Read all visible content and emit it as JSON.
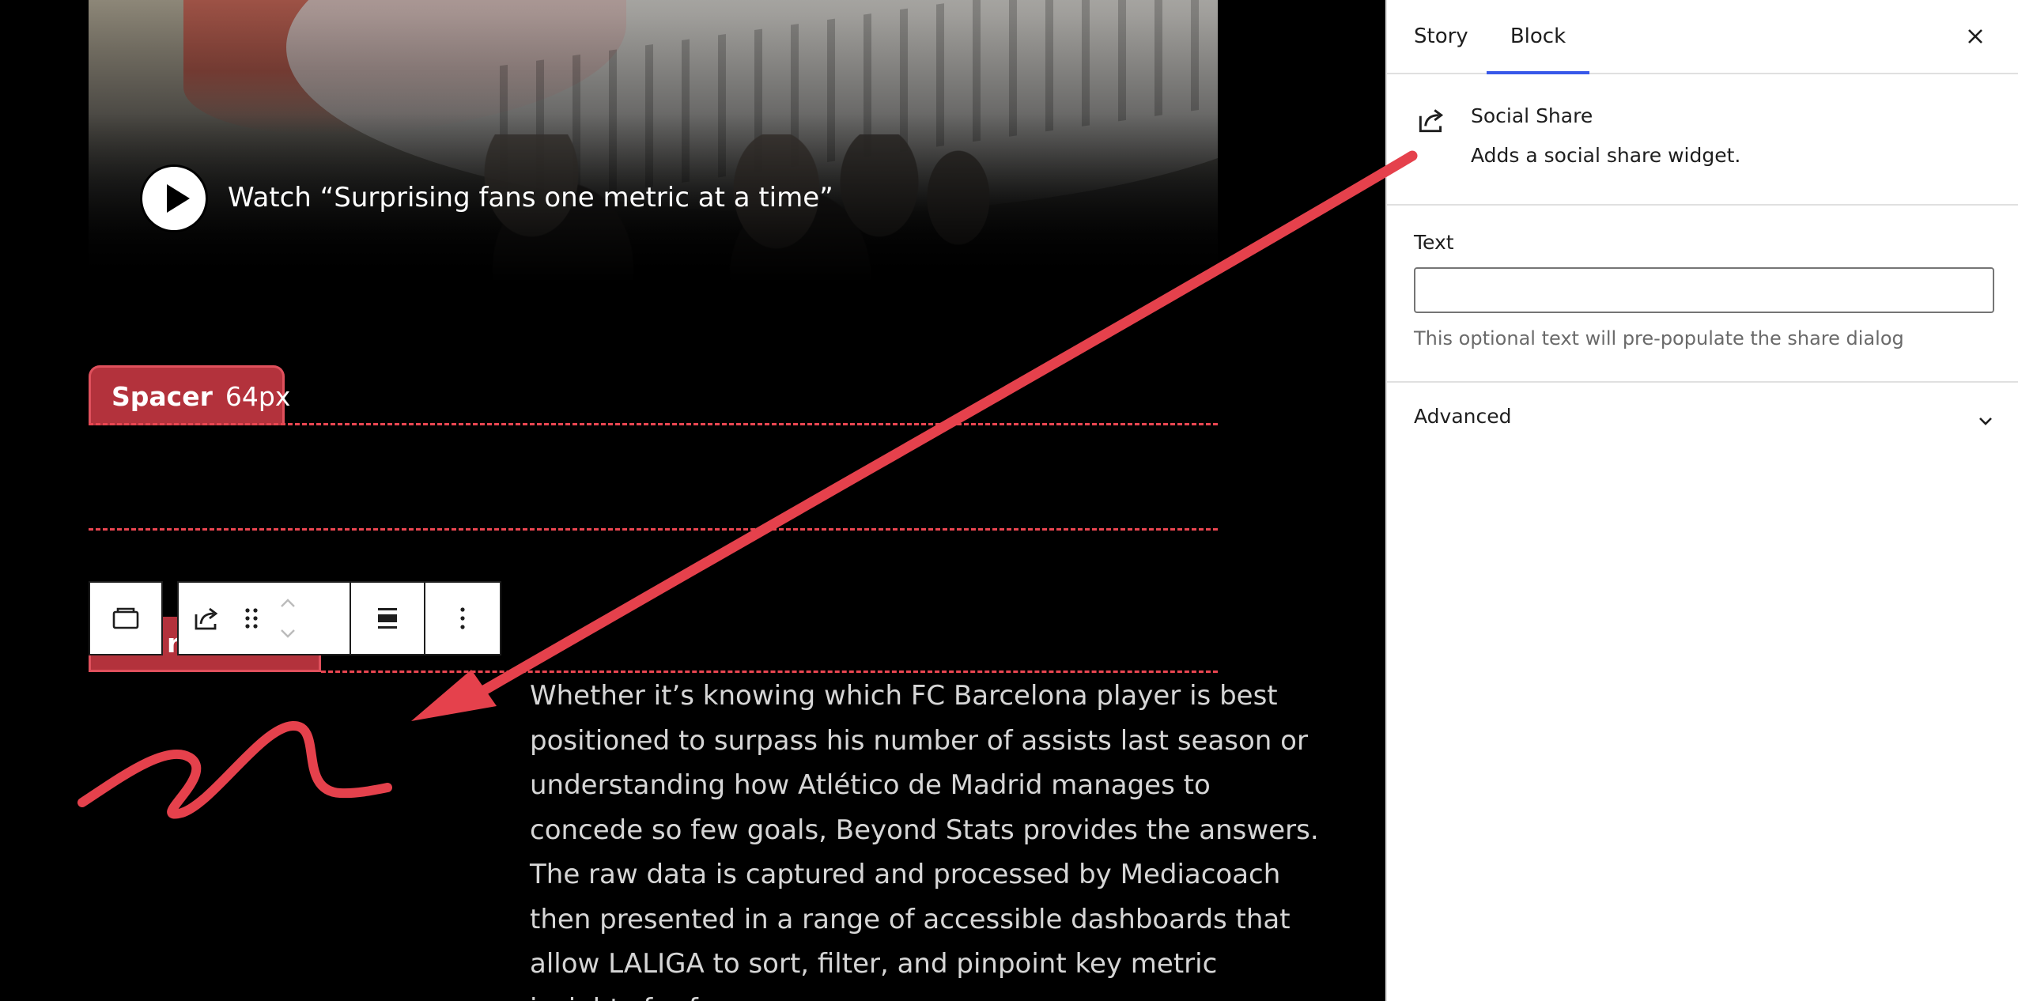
{
  "video": {
    "title": "Watch “Surprising fans one metric at a time”"
  },
  "spacer": {
    "name": "Spacer",
    "size": "64px"
  },
  "share_block_partial": "r",
  "toolbar": {
    "icons": [
      "parent-block-icon",
      "social-share-icon",
      "drag-handle-icon",
      "move-up-icon",
      "move-down-icon",
      "align-icon",
      "more-options-icon"
    ]
  },
  "body_text": {
    "lines": [
      "Whether it’s knowing which FC Barcelona player is best",
      "positioned to surpass his number of assists last season or",
      "understanding how Atlético de Madrid manages to",
      "concede so few goals, Beyond Stats provides the answers.",
      "The raw data is captured and processed by Mediacoach",
      "then presented in a range of accessible dashboards that",
      "allow LALIGA to sort, filter, and pinpoint key metric",
      "insights for fans."
    ]
  },
  "sidebar": {
    "tabs": [
      {
        "label": "Story"
      },
      {
        "label": "Block"
      }
    ],
    "active_tab": "Block",
    "block": {
      "title": "Social Share",
      "description": "Adds a social share widget."
    },
    "text_field": {
      "label": "Text",
      "value": "",
      "placeholder": "",
      "help": "This optional text will pre-populate the share dialog"
    },
    "advanced": {
      "label": "Advanced"
    }
  },
  "colors": {
    "accent": "#3858e9",
    "annotation": "#e5414c",
    "spacer": "#b3323c"
  }
}
